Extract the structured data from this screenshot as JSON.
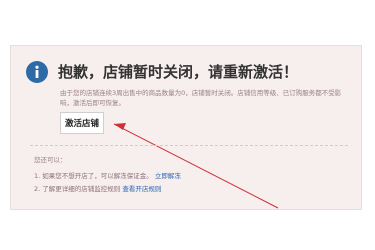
{
  "notice": {
    "title": "抱歉，店铺暂时关闭，请重新激活！",
    "description": "由于您的店铺连续3周出售中的商品数量为0，店铺暂时关闭。店铺信用等级、已订购服务都不受影响，激活后即可恢复。",
    "activate_button": "激活店铺"
  },
  "alternatives": {
    "heading": "您还可以：",
    "items": [
      {
        "prefix": "1. 如果您不想开店了，可以解冻保证金。",
        "link": "立即解冻"
      },
      {
        "prefix": "2. 了解更详细的店铺监控规则",
        "link": "查看开店规则"
      }
    ]
  },
  "colors": {
    "panel_background": "#f6efee",
    "info_icon": "#2e6aa6",
    "arrow": "#d02f3a",
    "link": "#2a63b5"
  }
}
